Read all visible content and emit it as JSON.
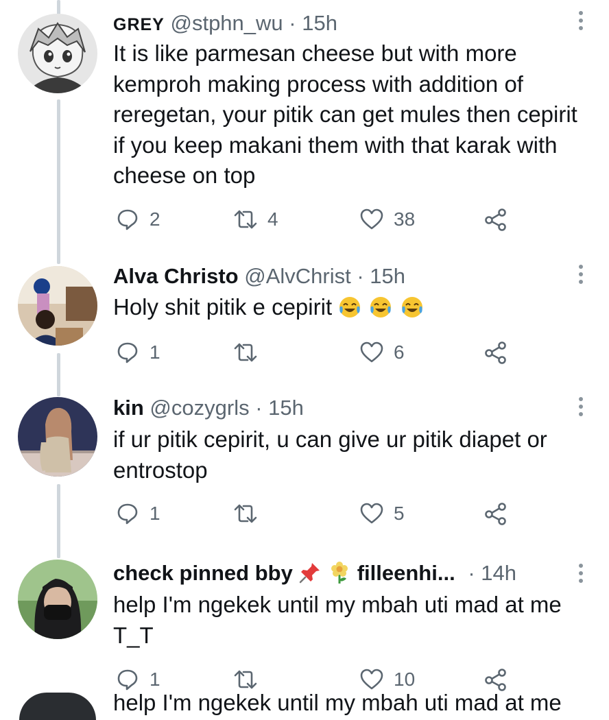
{
  "tweets": [
    {
      "name": "GREY",
      "handle": "@stphn_wu",
      "dot": "·",
      "time": "15h",
      "text": "It is like parmesan cheese but with more kemproh making process with addition of reregetan, your pitik can get mules then cepirit if you keep makani them with that karak with cheese on top",
      "replies": "2",
      "retweets": "4",
      "likes": "38"
    },
    {
      "name": "Alva Christo",
      "handle": "@AlvChrist",
      "dot": "·",
      "time": "15h",
      "text": "Holy shit pitik e cepirit",
      "emojis": [
        "face-with-tears-of-joy-icon",
        "face-with-tears-of-joy-icon",
        "face-with-tears-of-joy-icon"
      ],
      "replies": "1",
      "retweets": "",
      "likes": "6"
    },
    {
      "name": "kin",
      "handle": "@cozygrls",
      "dot": "·",
      "time": "15h",
      "text": "if ur pitik cepirit, u can give ur pitik diapet or entrostop",
      "replies": "1",
      "retweets": "",
      "likes": "5"
    },
    {
      "name": "check pinned bby",
      "name_icons": [
        "pushpin-icon",
        "blossom-icon"
      ],
      "name_suffix": "filleenhi...",
      "handle": "",
      "dot": "·",
      "time": "14h",
      "text": "help I'm ngekek until my mbah uti mad at me T_T",
      "replies": "1",
      "retweets": "",
      "likes": "10"
    }
  ],
  "cut_off_text": "help I'm ngekek until my mbah uti mad at me",
  "colors": {
    "text": "#111418",
    "secondary": "#5b6670",
    "thread_line": "#cfd6dc"
  }
}
